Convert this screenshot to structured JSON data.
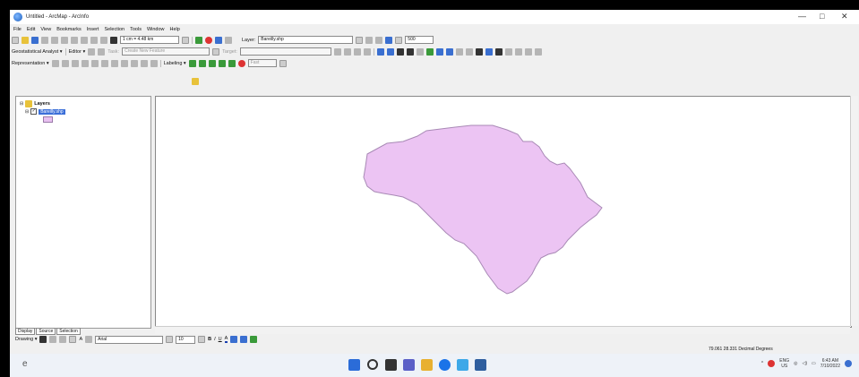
{
  "window": {
    "title": "Untitled - ArcMap - ArcInfo",
    "controls": [
      "—",
      "□",
      "✕"
    ]
  },
  "menubar": {
    "items": [
      "File",
      "Edit",
      "View",
      "Bookmarks",
      "Insert",
      "Selection",
      "Tools",
      "Window",
      "Help"
    ]
  },
  "standard_toolbar": {
    "scale": "1 cm = 4.48 km",
    "layer_label": "Layer:",
    "layer_value": "Bareilly.shp",
    "zoom_value": "500"
  },
  "geostat_toolbar": {
    "geostat_label": "Geostatistical Analyst ▾",
    "editor_label": "Editor ▾",
    "task_label": "Task:",
    "task_value": "Create New Feature",
    "target_label": "Target:"
  },
  "rep_toolbar": {
    "rep_label": "Representation ▾",
    "labeling_label": "Labeling ▾",
    "fast_value": "Fast"
  },
  "toc": {
    "root_label": "Layers",
    "layer_label": "Bareilly.shp",
    "tabs": [
      "Display",
      "Source",
      "Selection"
    ]
  },
  "drawing_toolbar": {
    "drawing_label": "Drawing ▾",
    "font_value": "Arial",
    "size_value": "10"
  },
  "statusbar": {
    "coords": "79.061 28.331 Decimal Degrees"
  },
  "tray": {
    "lang_top": "ENG",
    "lang_bottom": "US",
    "time": "6:43 AM",
    "date": "7/10/2022"
  },
  "colors": {
    "polygon_fill": "#ecc4f3",
    "polygon_stroke": "#a889b5",
    "selection": "#3b6fd8"
  }
}
